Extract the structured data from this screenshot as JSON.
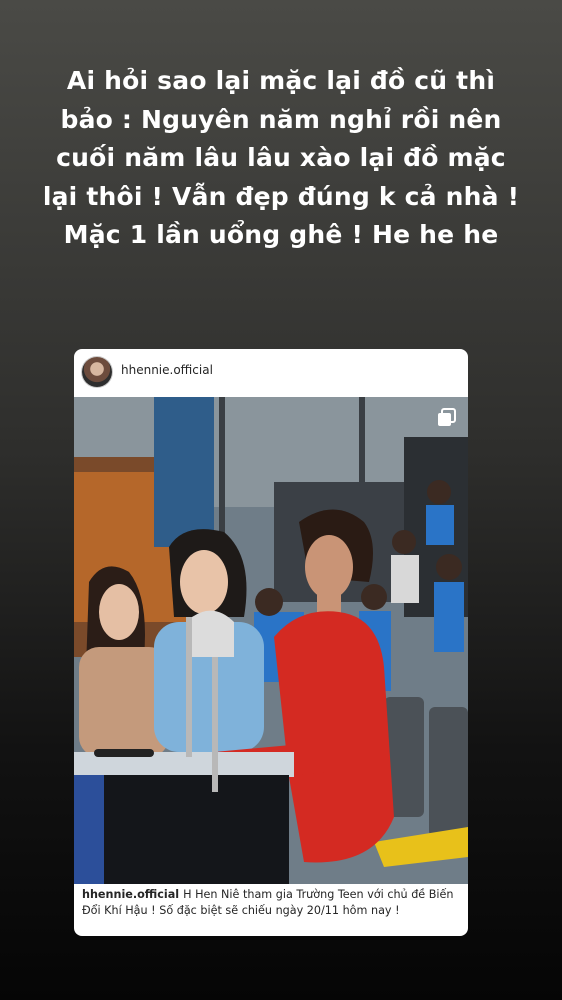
{
  "story": {
    "text": "Ai hỏi sao lại mặc lại đồ cũ thì bảo : Nguyên năm nghỉ rồi nên cuối năm lâu lâu xào lại đồ mặc lại thôi ! Vẫn đẹp đúng k cả nhà ! Mặc 1 lần uổng ghê !  He he he"
  },
  "post": {
    "username": "hhennie.official",
    "caption_user": "hhennie.official",
    "caption_text": "H Hen Niê tham gia Trường Teen với chủ đề Biến Đổi Khí Hậu ! Số đặc biệt sẽ chiếu ngày 20/11 hôm nay !",
    "multi_photo_icon": "carousel-icon"
  }
}
